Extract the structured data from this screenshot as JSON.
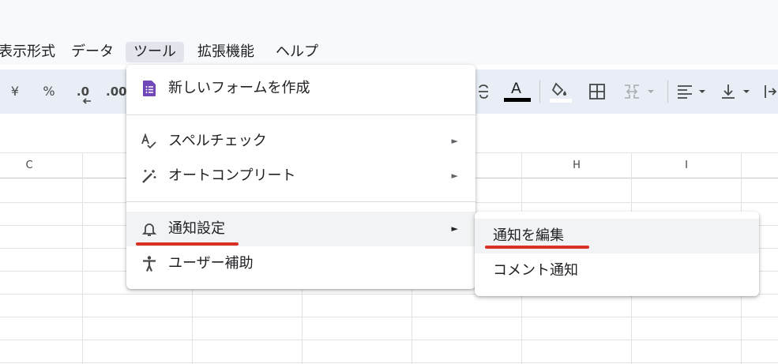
{
  "menubar": {
    "items": [
      {
        "label": "表示形式"
      },
      {
        "label": "データ"
      },
      {
        "label": "ツール"
      },
      {
        "label": "拡張機能"
      },
      {
        "label": "ヘルプ"
      }
    ]
  },
  "toolbar": {
    "yen": "¥",
    "percent": "%",
    "decimal_decrease": ".0",
    "decimal_increase": ".00",
    "text_color_letter": "A"
  },
  "columns": {
    "c": "C",
    "h": "H",
    "i": "I"
  },
  "tools_menu": {
    "items": [
      {
        "label": "新しいフォームを作成",
        "icon": "forms-icon"
      },
      {
        "label": "スペルチェック",
        "icon": "spellcheck-icon",
        "arrow": "►"
      },
      {
        "label": "オートコンプリート",
        "icon": "magic-wand-icon",
        "arrow": "►"
      },
      {
        "label": "通知設定",
        "icon": "bell-icon",
        "arrow": "►"
      },
      {
        "label": "ユーザー補助",
        "icon": "accessibility-icon"
      }
    ]
  },
  "notifications_submenu": {
    "items": [
      {
        "label": "通知を編集"
      },
      {
        "label": "コメント通知"
      }
    ]
  },
  "colors": {
    "forms_purple": "#7248b9",
    "annotation_red": "#d93025",
    "toolbar_bg": "#e9eef6",
    "menubar_bg": "#f8f9fc"
  }
}
